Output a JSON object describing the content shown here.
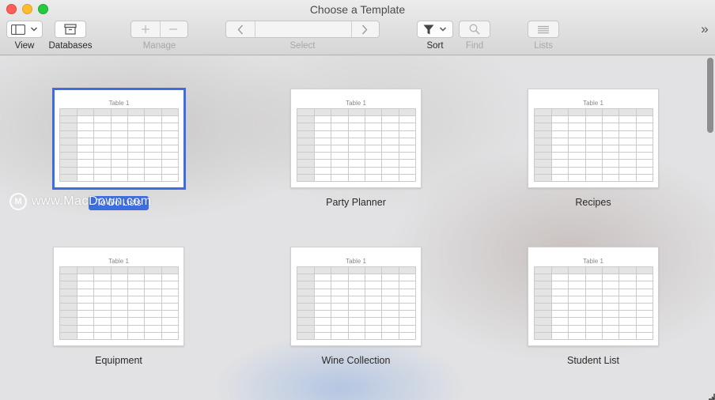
{
  "window": {
    "title": "Choose a Template"
  },
  "toolbar": {
    "view_label": "View",
    "databases_label": "Databases",
    "manage_label": "Manage",
    "select_label": "Select",
    "sort_label": "Sort",
    "find_label": "Find",
    "lists_label": "Lists",
    "overflow_glyph": "»"
  },
  "templates": [
    {
      "name": "To Do Lists",
      "table_title": "Table 1",
      "selected": true
    },
    {
      "name": "Party Planner",
      "table_title": "Table 1",
      "selected": false
    },
    {
      "name": "Recipes",
      "table_title": "Table 1",
      "selected": false
    },
    {
      "name": "Equipment",
      "table_title": "Table 1",
      "selected": false
    },
    {
      "name": "Wine Collection",
      "table_title": "Table 1",
      "selected": false
    },
    {
      "name": "Student List",
      "table_title": "Table 1",
      "selected": false
    }
  ],
  "watermark": {
    "text": "www.MacDown.com",
    "logo_glyph": "M"
  },
  "colors": {
    "accent": "#3e6ddf",
    "close": "#fe5f57",
    "minimize": "#febc2e",
    "maximize": "#28c840"
  }
}
